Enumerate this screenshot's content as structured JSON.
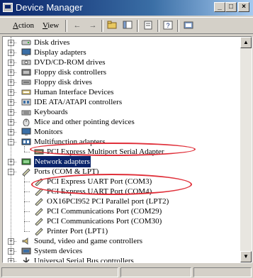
{
  "window": {
    "title": "Device Manager",
    "min_glyph": "_",
    "max_glyph": "□",
    "close_glyph": "×"
  },
  "menu": [
    {
      "label": "Action",
      "underline": "A",
      "rest": "ction"
    },
    {
      "label": "View",
      "underline": "V",
      "rest": "iew"
    }
  ],
  "toolbar": {
    "back": "←",
    "forward": "→"
  },
  "tree": [
    {
      "label": "Disk drives",
      "icon": "disk-drive-icon"
    },
    {
      "label": "Display adapters",
      "icon": "monitor-icon"
    },
    {
      "label": "DVD/CD-ROM drives",
      "icon": "cdrom-icon"
    },
    {
      "label": "Floppy disk controllers",
      "icon": "floppy-controller-icon"
    },
    {
      "label": "Floppy disk drives",
      "icon": "floppy-drive-icon"
    },
    {
      "label": "Human Interface Devices",
      "icon": "hid-icon"
    },
    {
      "label": "IDE ATA/ATAPI controllers",
      "icon": "ide-controller-icon"
    },
    {
      "label": "Keyboards",
      "icon": "keyboard-icon"
    },
    {
      "label": "Mice and other pointing devices",
      "icon": "mouse-icon"
    },
    {
      "label": "Monitors",
      "icon": "monitor-icon"
    },
    {
      "label": "Multifunction adapters",
      "icon": "multifunction-icon",
      "expanded": true
    },
    {
      "label": "PCI Express Multiport Serial Adapter",
      "icon": "serial-adapter-icon",
      "child": true
    },
    {
      "label": "Network adapters",
      "icon": "network-icon",
      "selected": true
    },
    {
      "label": "Ports (COM & LPT)",
      "icon": "port-icon",
      "expanded": true
    },
    {
      "label": "PCI Express UART Port (COM3)",
      "icon": "port-icon",
      "child": true
    },
    {
      "label": "PCI Express UART Port (COM4)",
      "icon": "port-icon",
      "child": true
    },
    {
      "label": "OX16PCI952 PCI Parallel port (LPT2)",
      "icon": "port-icon",
      "child": true
    },
    {
      "label": "PCI Communications Port (COM29)",
      "icon": "port-icon",
      "child": true
    },
    {
      "label": "PCI Communications Port (COM30)",
      "icon": "port-icon",
      "child": true
    },
    {
      "label": "Printer Port (LPT1)",
      "icon": "port-icon",
      "child": true
    },
    {
      "label": "Sound, video and game controllers",
      "icon": "sound-icon"
    },
    {
      "label": "System devices",
      "icon": "system-icon"
    },
    {
      "label": "Universal Serial Bus controllers",
      "icon": "usb-icon"
    }
  ],
  "colors": {
    "highlight": "#0a246a",
    "annotation": "#e0303a"
  }
}
